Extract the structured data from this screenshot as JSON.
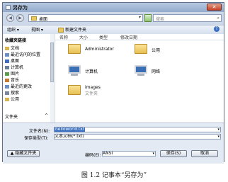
{
  "window": {
    "title": "另存为",
    "close_label": "✕"
  },
  "nav": {
    "back_icon": "back-arrow-icon",
    "forward_icon": "forward-arrow-icon",
    "address": "桌面",
    "address_dropdown": "▾",
    "search_placeholder": "搜索",
    "search_icon": "⌕"
  },
  "toolbar": {
    "organize": "组织 ▾",
    "views": "视图 ▾",
    "new_folder": "新建文件夹",
    "help": "?"
  },
  "sidebar": {
    "header": "收藏夹链接",
    "items": [
      {
        "label": "文档",
        "color": "#d9b44a"
      },
      {
        "label": "最近访问的位置",
        "color": "#6d8fc7"
      },
      {
        "label": "桌面",
        "color": "#3a6fc1"
      },
      {
        "label": "计算机",
        "color": "#6a7d99"
      },
      {
        "label": "图片",
        "color": "#5f9c4c"
      },
      {
        "label": "音乐",
        "color": "#c9772f"
      },
      {
        "label": "最近的更改",
        "color": "#6d8fc7"
      },
      {
        "label": "搜索",
        "color": "#7a86a0"
      },
      {
        "label": "公用",
        "color": "#d9b44a"
      }
    ],
    "folders_label": "文件夹",
    "folders_toggle": "^"
  },
  "columns": {
    "name": "名称",
    "size": "大小",
    "type": "类型",
    "modified": "修改日期"
  },
  "files": [
    {
      "name": "Administrator",
      "sub": ""
    },
    {
      "name": "公用",
      "sub": ""
    },
    {
      "name": "计算机",
      "sub": ""
    },
    {
      "name": "网络",
      "sub": ""
    },
    {
      "name": "images",
      "sub": "文件夹"
    }
  ],
  "form": {
    "filename_label": "文件名(N):",
    "filename_value": "helloworld.txt",
    "savetype_label": "保存类型(T):",
    "savetype_value": "文本文档(*.txt)",
    "hide_folders": "隐藏文件夹",
    "encoding_label": "编码(E):",
    "encoding_value": "ANSI",
    "save_button": "保存(S)",
    "cancel_button": "取消"
  },
  "caption": "图 1.2    记事本“另存为”"
}
